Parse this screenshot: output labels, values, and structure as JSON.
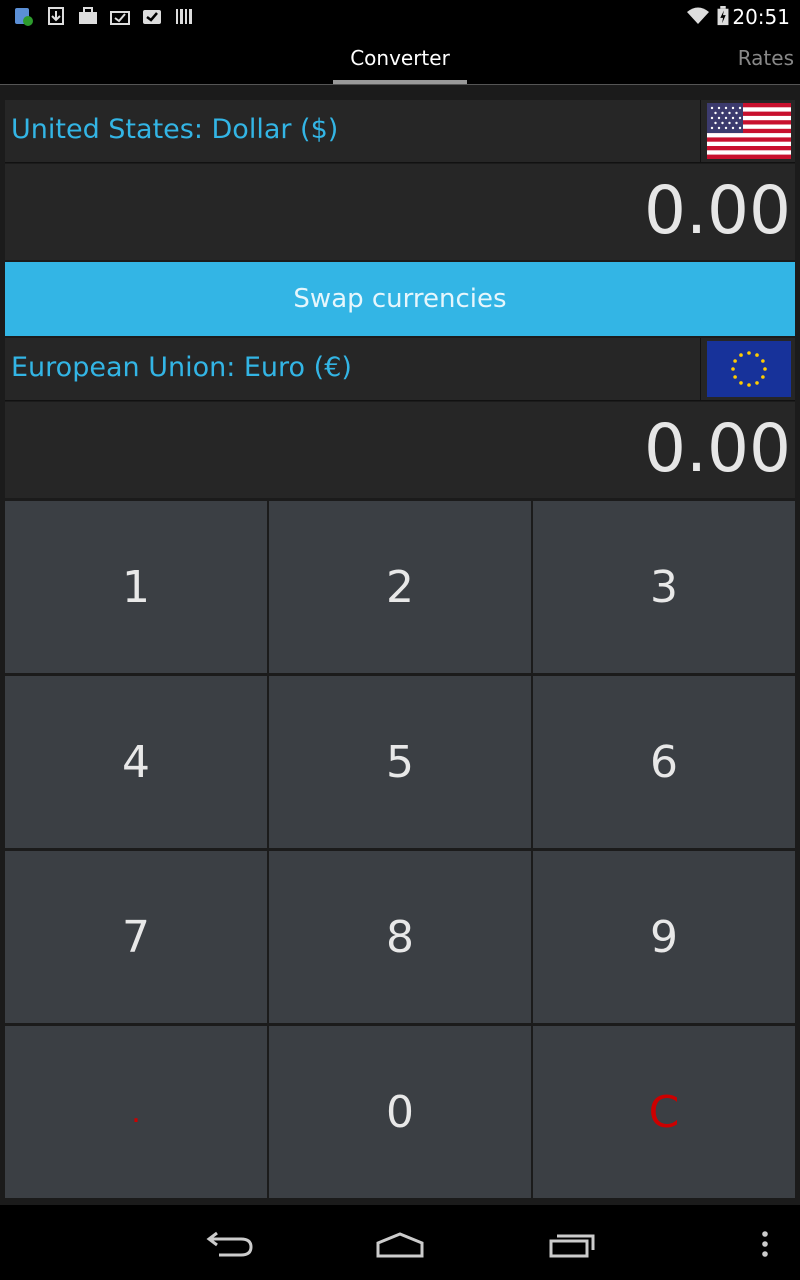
{
  "status_bar": {
    "time": "20:51",
    "notification_icons": [
      "shield-icon",
      "download-icon",
      "briefcase-icon",
      "task-icon",
      "clipboard-check-icon",
      "barcode-icon"
    ],
    "system_icons": [
      "wifi-icon",
      "battery-charging-icon"
    ]
  },
  "tabs": [
    {
      "label": "Converter",
      "active": true
    },
    {
      "label": "Rates",
      "active": false
    }
  ],
  "from_currency": {
    "name": "United States: Dollar ($)",
    "flag": "us-flag-icon",
    "amount": "0.00"
  },
  "swap_label": "Swap currencies",
  "to_currency": {
    "name": "European Union: Euro (€)",
    "flag": "eu-flag-icon",
    "amount": "0.00"
  },
  "keypad": {
    "keys": [
      "1",
      "2",
      "3",
      "4",
      "5",
      "6",
      "7",
      "8",
      "9",
      ".",
      "0",
      "C"
    ]
  },
  "nav_bar": {
    "icons": [
      "back-icon",
      "home-icon",
      "recent-apps-icon",
      "overflow-menu-icon"
    ]
  },
  "colors": {
    "accent": "#33b5e5",
    "key_background": "#3b3f44",
    "clear_key": "#cc0000"
  }
}
